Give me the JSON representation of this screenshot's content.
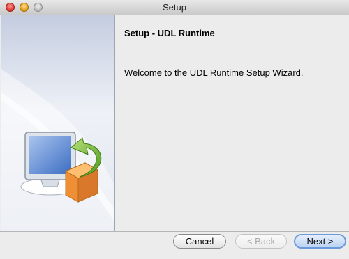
{
  "window": {
    "title": "Setup"
  },
  "content": {
    "heading": "Setup - UDL Runtime",
    "welcome": "Welcome to the UDL Runtime Setup Wizard."
  },
  "buttons": {
    "cancel": "Cancel",
    "back": "< Back",
    "next": "Next >"
  },
  "icons": {
    "sidebar_art": "computer-with-install-box-icon"
  }
}
